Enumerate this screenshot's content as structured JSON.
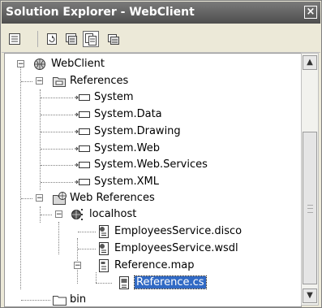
{
  "window": {
    "title": "Solution Explorer - WebClient",
    "close_glyph": "×"
  },
  "toolbar": {
    "buttons": [
      {
        "name": "properties-button",
        "icon": "properties-icon"
      },
      {
        "name": "refresh-button",
        "icon": "refresh-icon"
      },
      {
        "name": "view-code-button",
        "icon": "view-code-icon"
      },
      {
        "name": "show-all-files-button",
        "icon": "show-all-files-icon",
        "pressed": true
      },
      {
        "name": "copy-project-button",
        "icon": "copy-project-icon"
      }
    ]
  },
  "tree": {
    "items": [
      {
        "label": "WebClient",
        "icon": "web-project-icon",
        "expanded": true
      },
      {
        "label": "References",
        "icon": "references-folder-icon",
        "expanded": true
      },
      {
        "label": "System",
        "icon": "assembly-reference-icon"
      },
      {
        "label": "System.Data",
        "icon": "assembly-reference-icon"
      },
      {
        "label": "System.Drawing",
        "icon": "assembly-reference-icon"
      },
      {
        "label": "System.Web",
        "icon": "assembly-reference-icon"
      },
      {
        "label": "System.Web.Services",
        "icon": "assembly-reference-icon"
      },
      {
        "label": "System.XML",
        "icon": "assembly-reference-icon"
      },
      {
        "label": "Web References",
        "icon": "web-references-folder-icon",
        "expanded": true
      },
      {
        "label": "localhost",
        "icon": "web-service-icon",
        "expanded": true
      },
      {
        "label": "EmployeesService.disco",
        "icon": "disco-file-icon"
      },
      {
        "label": "EmployeesService.wsdl",
        "icon": "wsdl-file-icon"
      },
      {
        "label": "Reference.map",
        "icon": "map-file-icon",
        "expanded": true
      },
      {
        "label": "Reference.cs",
        "icon": "cs-file-icon",
        "selected": true
      },
      {
        "label": "bin",
        "icon": "folder-icon"
      }
    ]
  },
  "colors": {
    "selection": "#316ac5",
    "title_bar": "#5a5a5a"
  }
}
